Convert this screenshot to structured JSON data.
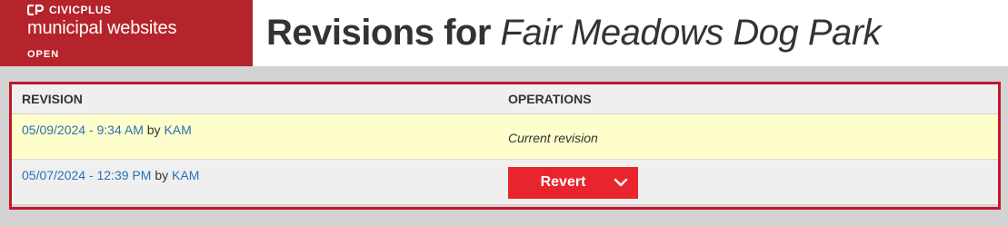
{
  "brand": {
    "name": "CIVICPLUS",
    "product": "municipal websites",
    "status": "OPEN",
    "color": "#b5242b"
  },
  "title": {
    "prefix": "Revisions for ",
    "node": "Fair Meadows Dog Park"
  },
  "table": {
    "headers": {
      "revision": "REVISION",
      "operations": "OPERATIONS"
    },
    "rows": [
      {
        "date": "05/09/2024 - 9:34 AM",
        "by": " by ",
        "author": "KAM",
        "operation": "Current revision"
      },
      {
        "date": "05/07/2024 - 12:39 PM",
        "by": " by ",
        "author": "KAM",
        "operation": "Revert",
        "operation_icon": "chevron-down-icon"
      }
    ]
  },
  "colors": {
    "accent": "#e8242c",
    "link": "#2a70b6",
    "current_row": "#fefdcc",
    "highlight_border": "#c0172a"
  }
}
